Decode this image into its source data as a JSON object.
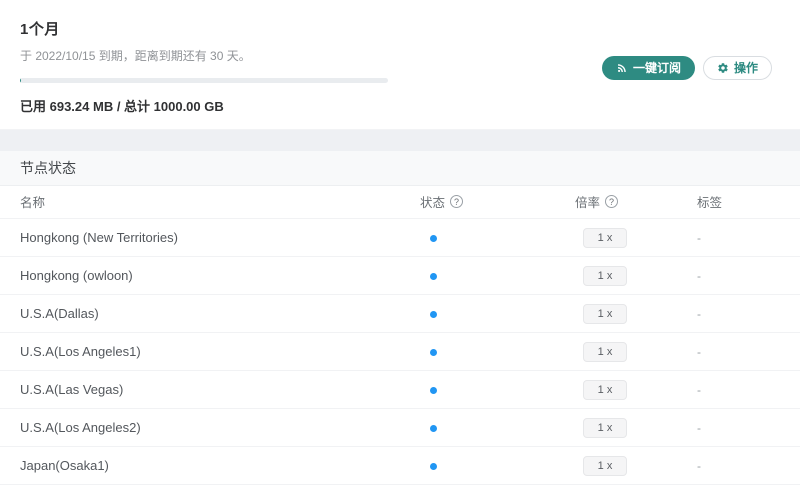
{
  "plan": {
    "title": "1个月",
    "expiry_note": "于 2022/10/15 到期，距离到期还有 30 天。",
    "usage_text": "已用 693.24 MB / 总计 1000.00 GB",
    "used": "693.24 MB",
    "total": "1000.00 GB",
    "progress_percent": 0.07,
    "subscribe_label": "一键订阅",
    "actions_label": "操作"
  },
  "node_status": {
    "section_title": "节点状态",
    "columns": {
      "name": "名称",
      "status": "状态",
      "rate": "倍率",
      "tags": "标签"
    },
    "help_glyph": "?",
    "rows": [
      {
        "name": "Hongkong (New Territories)",
        "status": "online",
        "rate": "1 x",
        "tags": "-"
      },
      {
        "name": "Hongkong (owloon)",
        "status": "online",
        "rate": "1 x",
        "tags": "-"
      },
      {
        "name": "U.S.A(Dallas)",
        "status": "online",
        "rate": "1 x",
        "tags": "-"
      },
      {
        "name": "U.S.A(Los Angeles1)",
        "status": "online",
        "rate": "1 x",
        "tags": "-"
      },
      {
        "name": "U.S.A(Las Vegas)",
        "status": "online",
        "rate": "1 x",
        "tags": "-"
      },
      {
        "name": "U.S.A(Los Angeles2)",
        "status": "online",
        "rate": "1 x",
        "tags": "-"
      },
      {
        "name": "Japan(Osaka1)",
        "status": "online",
        "rate": "1 x",
        "tags": "-"
      }
    ]
  },
  "colors": {
    "accent_teal": "#2e8b82",
    "status_dot_blue": "#2196f3",
    "badge_bg": "#f5f5f6",
    "section_header_bg": "#f8f9fa",
    "gap_band_bg": "#eef0f3"
  }
}
